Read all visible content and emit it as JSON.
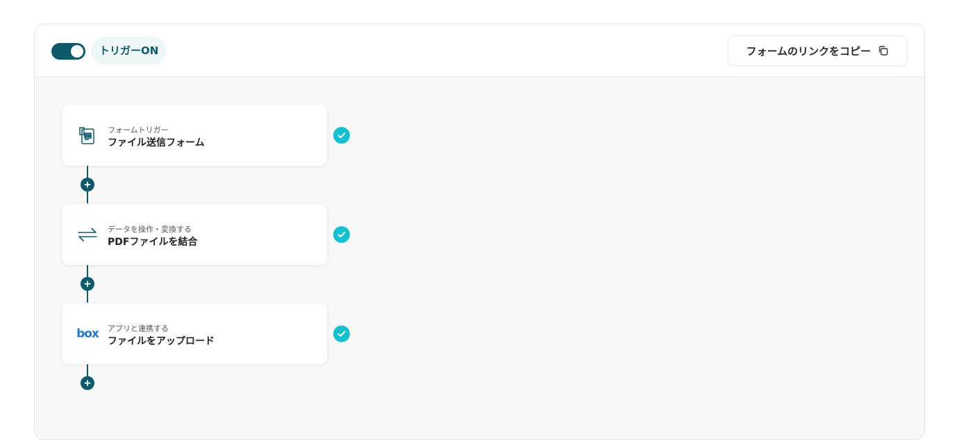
{
  "header": {
    "trigger_toggle_state": "on",
    "trigger_label": "トリガーON",
    "copy_link_label": "フォームのリンクをコピー"
  },
  "steps": [
    {
      "category": "フォームトリガー",
      "title": "ファイル送信フォーム",
      "icon": "form-icon",
      "status": "complete"
    },
    {
      "category": "データを操作・変換する",
      "title": "PDFファイルを結合",
      "icon": "transform-arrows-icon",
      "status": "complete"
    },
    {
      "category": "アプリと連携する",
      "title": "ファイルをアップロード",
      "icon": "box-logo",
      "status": "complete",
      "logo_text": "box"
    }
  ],
  "colors": {
    "primary": "#0e5a6d",
    "check": "#12c0d0",
    "box_brand": "#1f78d1",
    "pill_bg": "#eef7f8"
  }
}
